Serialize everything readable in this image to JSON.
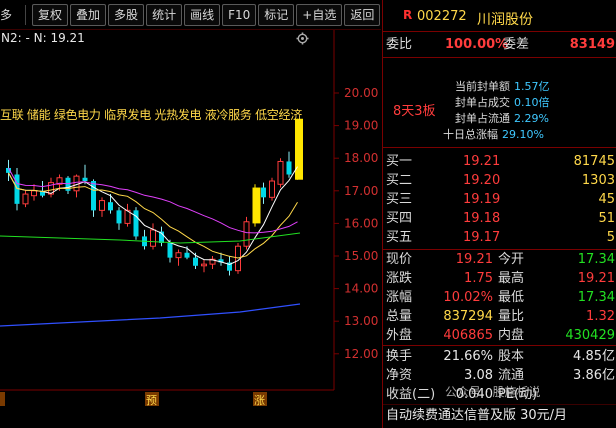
{
  "toolbar": {
    "first": "多",
    "buttons": [
      "复权",
      "叠加",
      "多股",
      "统计",
      "画线",
      "F10",
      "标记",
      "+自选",
      "返回"
    ]
  },
  "chart": {
    "ma_label": "N2: - N: 19.21",
    "concepts": "互联 储能 绿色电力 临界发电 光热发电 液冷服务 低空经济",
    "price_ticks": [
      "20.00",
      "19.00",
      "18.00",
      "17.00",
      "16.00",
      "15.00",
      "14.00",
      "13.00",
      "12.00"
    ],
    "bottom_markers": [
      "预",
      "涨"
    ],
    "colors": {
      "up": "#ff3c3c",
      "down": "#00d8e8",
      "limit": "#ffe600",
      "ma5": "#ffffff",
      "ma10": "#ffd84a",
      "ma20": "#e040fb",
      "ma60": "#22e022",
      "ma250": "#3050ff"
    }
  },
  "panel": {
    "code": "002272",
    "name": "川润股份",
    "weibi_label": "委比",
    "weibi_value": "100.00%",
    "weicha_label": "委差",
    "weicha_value": "83149",
    "board": "8天3板",
    "fengdan": [
      {
        "k": "当前封单额",
        "v": "1.57亿"
      },
      {
        "k": "封单占成交",
        "v": "0.10倍"
      },
      {
        "k": "封单占流通",
        "v": "2.29%"
      },
      {
        "k": "十日总涨幅",
        "v": "29.10%"
      }
    ],
    "sell": [
      {
        "label": "卖一",
        "price": "",
        "qty": ""
      }
    ],
    "buy": [
      {
        "label": "买一",
        "price": "19.21",
        "qty": "81745"
      },
      {
        "label": "买二",
        "price": "19.20",
        "qty": "1303"
      },
      {
        "label": "买三",
        "price": "19.19",
        "qty": "45"
      },
      {
        "label": "买四",
        "price": "19.18",
        "qty": "51"
      },
      {
        "label": "买五",
        "price": "19.17",
        "qty": "5"
      }
    ],
    "quote": [
      {
        "l1": "现价",
        "v1": "19.21",
        "c1": "red",
        "l2": "今开",
        "v2": "17.34",
        "c2": "green"
      },
      {
        "l1": "涨跌",
        "v1": "1.75",
        "c1": "red",
        "l2": "最高",
        "v2": "19.21",
        "c2": "red"
      },
      {
        "l1": "涨幅",
        "v1": "10.02%",
        "c1": "red",
        "l2": "最低",
        "v2": "17.34",
        "c2": "green"
      },
      {
        "l1": "总量",
        "v1": "837294",
        "c1": "yellow",
        "l2": "量比",
        "v2": "1.32",
        "c2": "red"
      },
      {
        "l1": "外盘",
        "v1": "406865",
        "c1": "red",
        "l2": "内盘",
        "v2": "430429",
        "c2": "green"
      }
    ],
    "stats": [
      {
        "l1": "换手",
        "v1": "21.66%",
        "l2": "股本",
        "v2": "4.85亿"
      },
      {
        "l1": "净资",
        "v1": "3.08",
        "l2": "流通",
        "v2": "3.86亿"
      },
      {
        "l1": "收益(二)",
        "v1": "0.040",
        "l2": "PE(动)",
        "v2": ""
      }
    ],
    "bottom_text": "自动续费通达信普及版  30元/月",
    "watermark": "公众号 · 股施析说"
  }
}
